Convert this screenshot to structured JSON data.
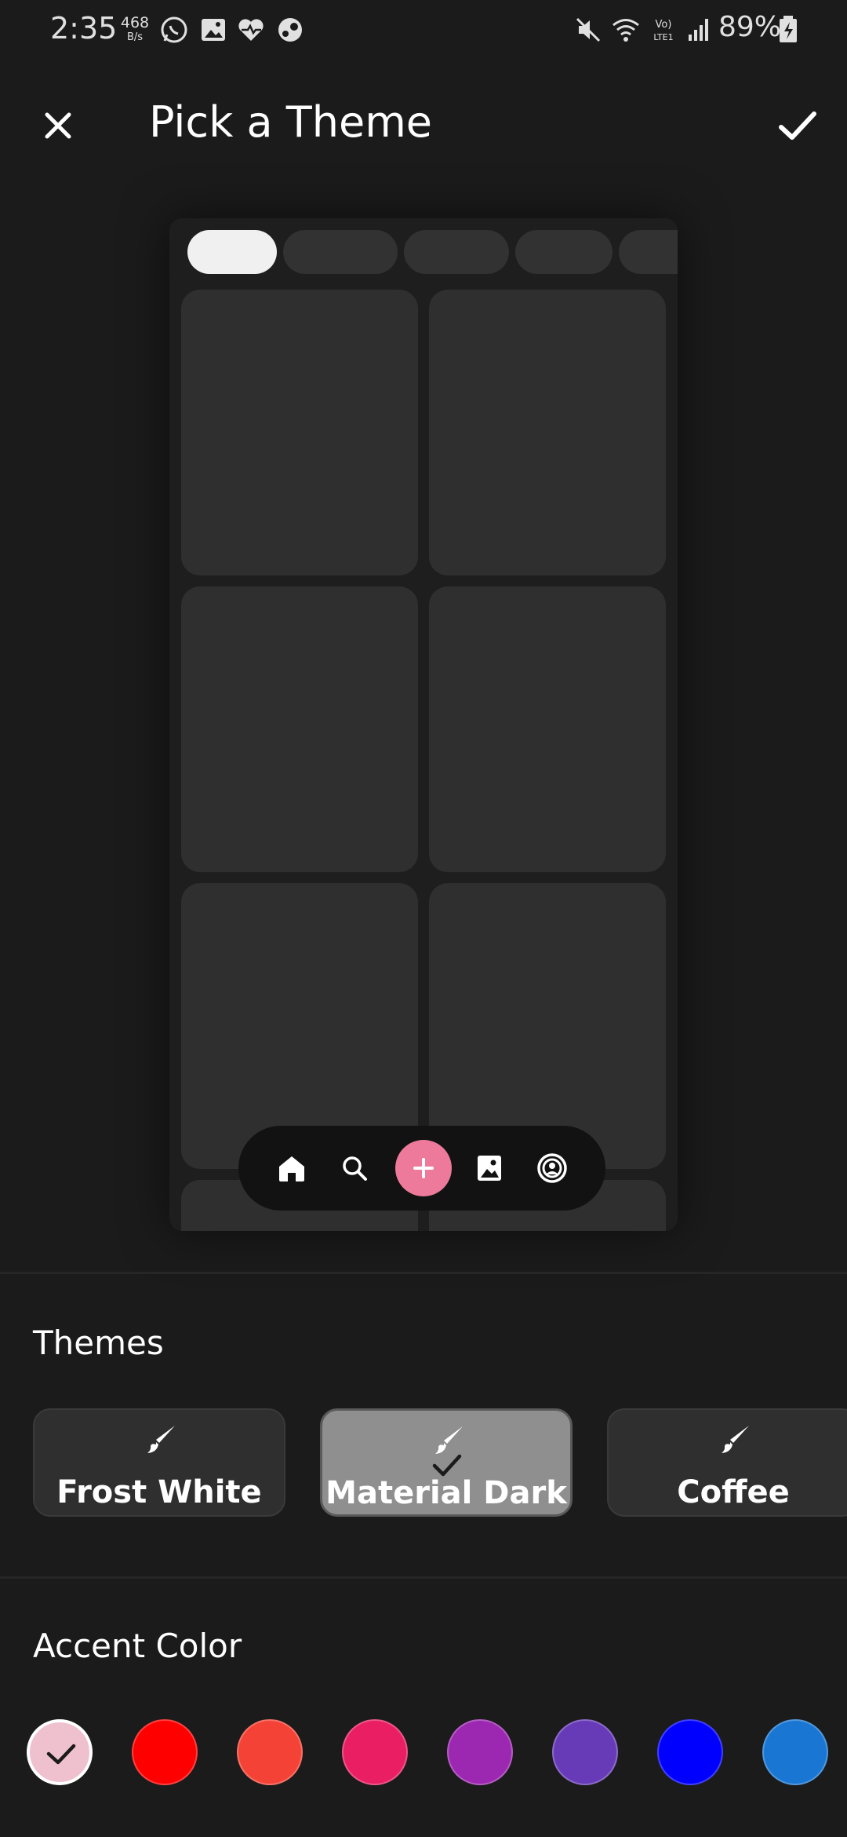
{
  "status_bar": {
    "time": "2:35",
    "net_speed_value": "468",
    "net_speed_unit": "B/s",
    "battery": "89%",
    "icons": [
      "whatsapp-icon",
      "gallery-icon",
      "heart-icon",
      "steam-icon",
      "mute-icon",
      "wifi-icon",
      "volte-icon",
      "signal-icon",
      "battery-icon"
    ]
  },
  "app_bar": {
    "title": "Pick a Theme",
    "close_icon": "close-icon",
    "confirm_icon": "check-icon"
  },
  "preview": {
    "nav_icons": [
      "home-icon",
      "search-icon",
      "add-icon",
      "image-icon",
      "profile-icon"
    ],
    "accent": "#ee7a9b"
  },
  "themes": {
    "label": "Themes",
    "items": [
      {
        "name": "Frost White",
        "selected": false
      },
      {
        "name": "Material Dark",
        "selected": true
      },
      {
        "name": "Coffee",
        "selected": false
      }
    ]
  },
  "accent": {
    "label": "Accent Color",
    "colors": [
      "#efc1cf",
      "#ff0000",
      "#f44336",
      "#e91e63",
      "#9c27b0",
      "#673ab7",
      "#0000ff",
      "#1976d2"
    ],
    "selected_index": 0
  }
}
